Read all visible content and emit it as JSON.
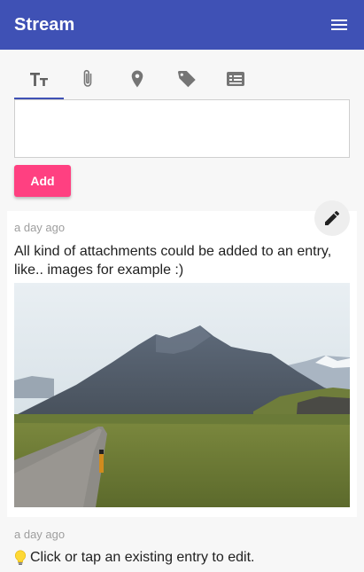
{
  "appbar": {
    "title": "Stream",
    "menu_icon": "hamburger-menu-icon",
    "color": "#3f51b5"
  },
  "tabs": [
    {
      "icon": "text-format-icon",
      "active": true
    },
    {
      "icon": "attachment-icon",
      "active": false
    },
    {
      "icon": "location-pin-icon",
      "active": false
    },
    {
      "icon": "tag-icon",
      "active": false
    },
    {
      "icon": "subtitles-icon",
      "active": false
    }
  ],
  "composer": {
    "text_value": "",
    "placeholder": "",
    "add_label": "Add",
    "add_color": "#ff4081"
  },
  "entries": [
    {
      "time": "a day ago",
      "text": "All kind of attachments could be added to an entry, like.. images for example :)",
      "edit_icon": "pencil-icon",
      "image": "mountain-landscape-photo"
    },
    {
      "time": "a day ago",
      "icon": "lightbulb-icon",
      "text": "Click or tap an existing entry to edit."
    }
  ]
}
